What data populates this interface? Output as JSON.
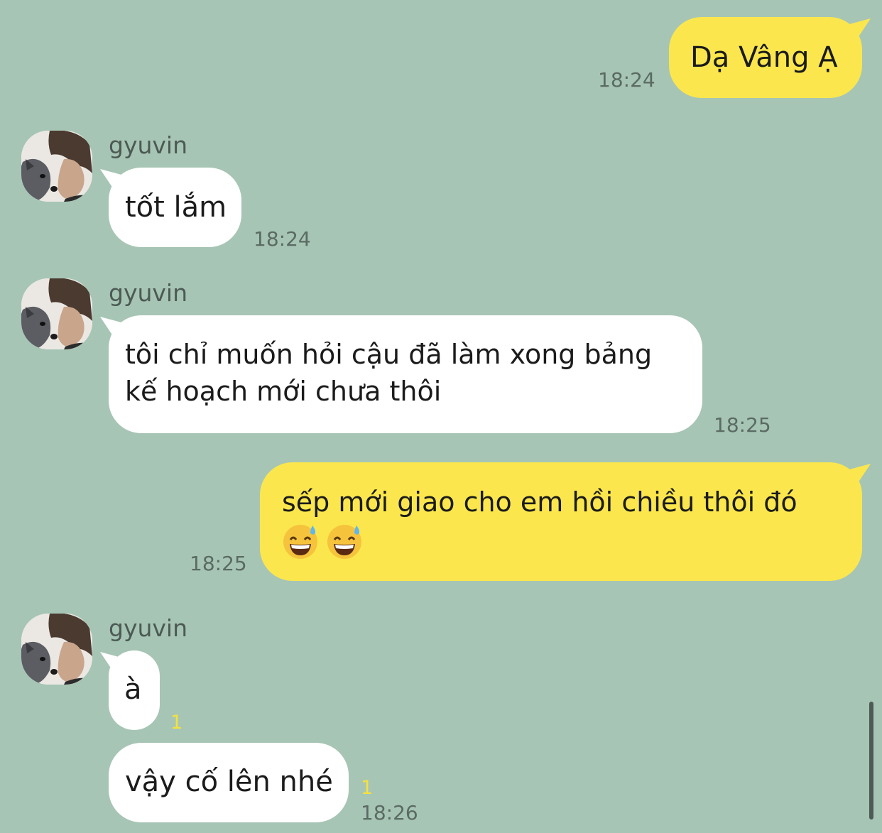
{
  "chat": {
    "messages": [
      {
        "sender": "me",
        "text": "Dạ Vâng Ạ",
        "time": "18:24"
      },
      {
        "sender": "gyuvin",
        "text": "tốt lắm",
        "time": "18:24"
      },
      {
        "sender": "gyuvin",
        "lines": [
          "tôi chỉ muốn hỏi cậu đã làm xong bảng",
          "kế hoạch mới chưa thôi"
        ],
        "time": "18:25"
      },
      {
        "sender": "me",
        "text": "sếp mới giao cho em hồi chiều thôi đó",
        "emoji": [
          "grinning-face-with-sweat",
          "grinning-face-with-sweat"
        ],
        "time": "18:25"
      },
      {
        "sender": "gyuvin",
        "text": "à",
        "unread": "1"
      },
      {
        "sender": "gyuvin",
        "text": "vậy cố lên nhé",
        "unread": "1",
        "time": "18:26"
      }
    ],
    "contact": {
      "name": "gyuvin",
      "avatar_icon": "profile-photo-icon"
    }
  },
  "colors": {
    "background": "#a7c5b5",
    "outgoing_bubble": "#fbe74d",
    "incoming_bubble": "#ffffff",
    "unread_count": "#f5e23c",
    "timestamp": "#5a6b63"
  }
}
